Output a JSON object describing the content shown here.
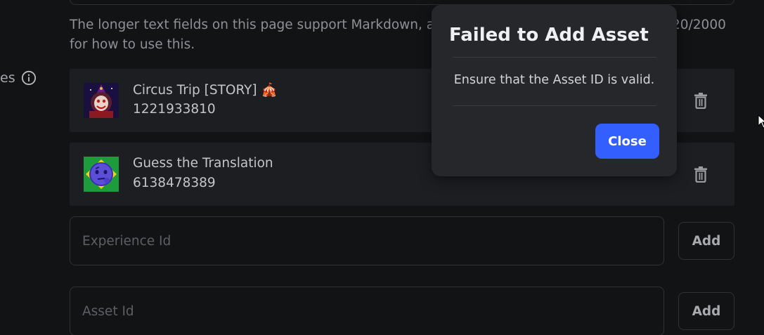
{
  "help": {
    "text_line1": "The longer text fields on this page support Markdown, al",
    "text_line2": "for how to use this.",
    "char_count": "20/2000"
  },
  "section": {
    "label": "es"
  },
  "assets": [
    {
      "name": "Circus Trip [STORY]",
      "badge": "🎪",
      "id": "1221933810"
    },
    {
      "name": "Guess the Translation",
      "badge": "",
      "id": "6138478389"
    }
  ],
  "experience_input": {
    "placeholder": "Experience Id",
    "value": "",
    "add_label": "Add"
  },
  "asset_input": {
    "placeholder": "Asset Id",
    "value": "",
    "add_label": "Add"
  },
  "modal": {
    "title": "Failed to Add Asset",
    "message": "Ensure that the Asset ID is valid.",
    "close_label": "Close"
  },
  "colors": {
    "background": "#121315",
    "row_background": "#1d1e21",
    "modal_background": "#26272b",
    "primary_button": "#335fff"
  }
}
